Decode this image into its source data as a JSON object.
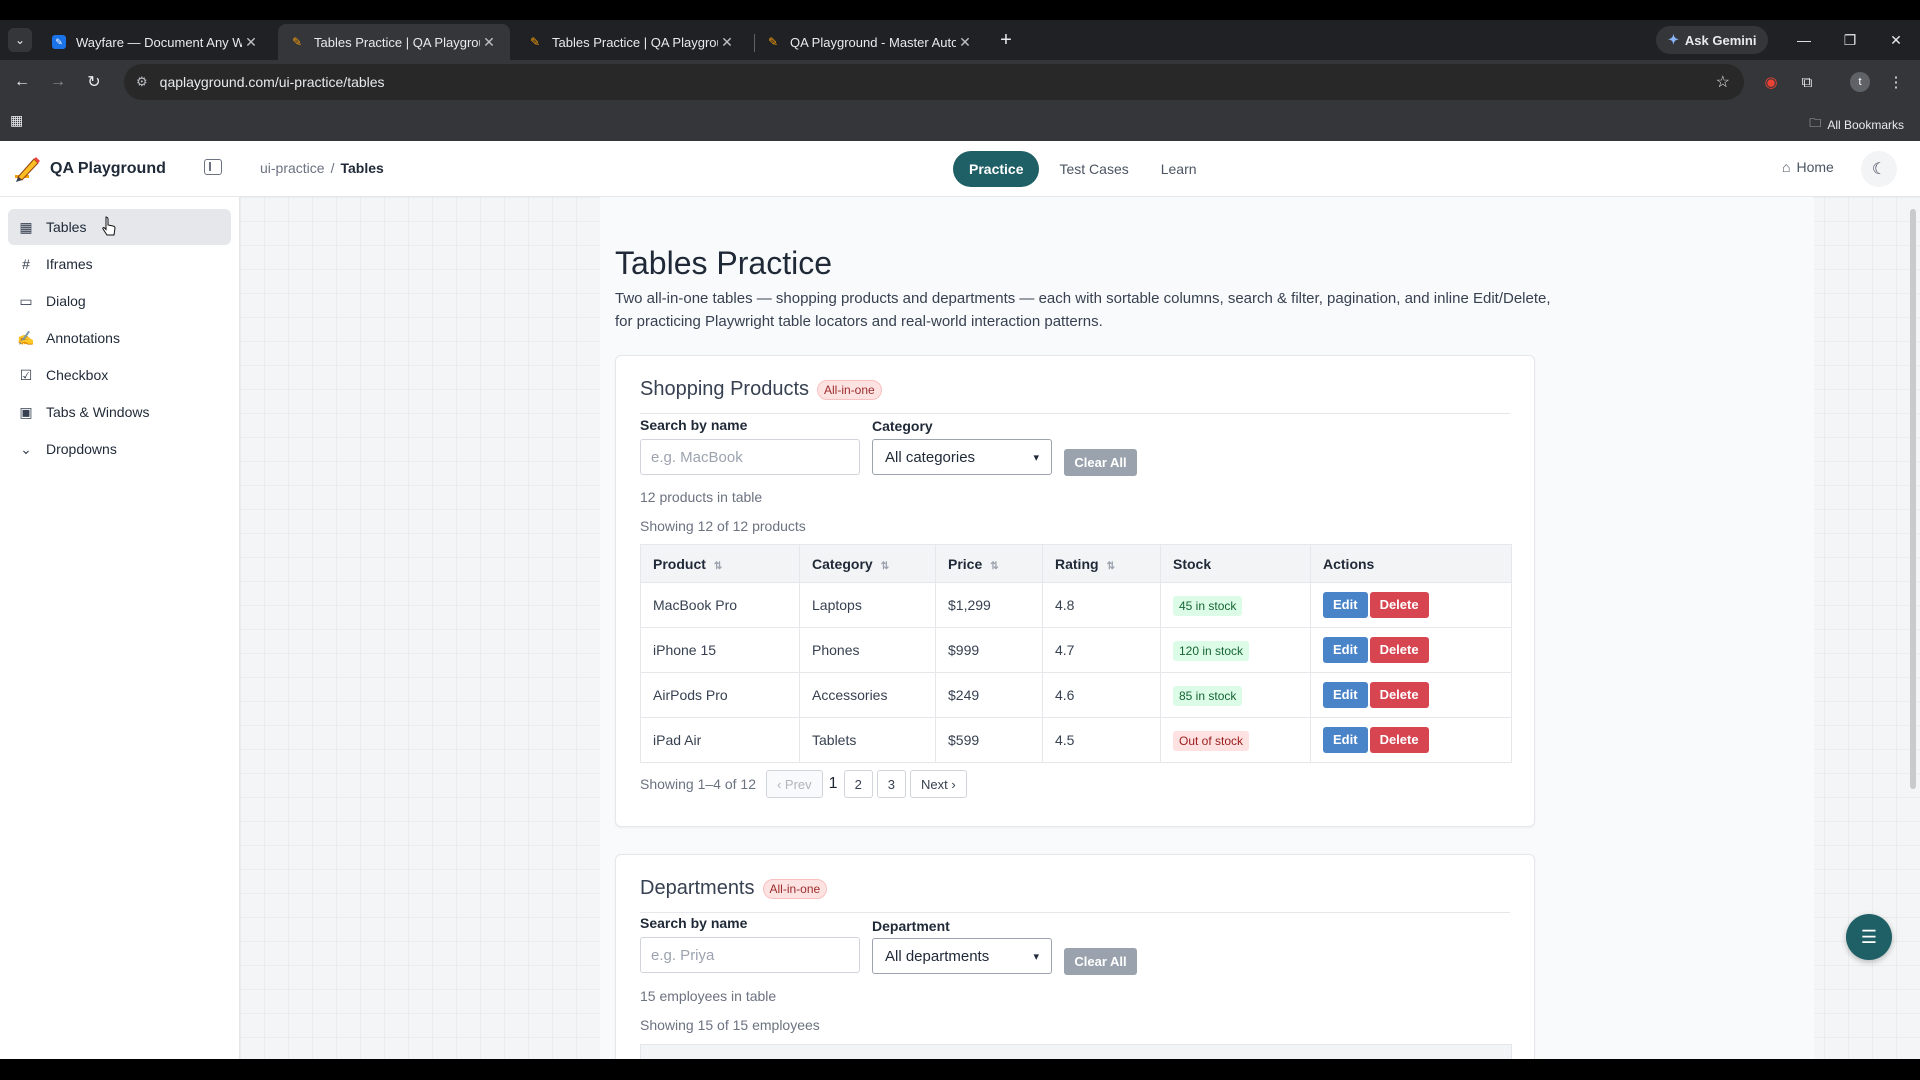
{
  "browser": {
    "tabs": [
      {
        "title": "Wayfare — Document Any Wor",
        "active": false,
        "favicon": "doc-icon"
      },
      {
        "title": "Tables Practice | QA Playground",
        "active": true,
        "favicon": "pencil-icon"
      },
      {
        "title": "Tables Practice | QA Playground",
        "active": false,
        "favicon": "pencil-icon"
      },
      {
        "title": "QA Playground - Master Autom",
        "active": false,
        "favicon": "pencil-icon"
      }
    ],
    "ask_gemini": "Ask Gemini",
    "url": "qaplayground.com/ui-practice/tables",
    "all_bookmarks": "All Bookmarks",
    "profile_initial": "t"
  },
  "app": {
    "brand": "QA Playground",
    "breadcrumb": {
      "parent": "ui-practice",
      "separator": "/",
      "current": "Tables"
    },
    "nav": [
      {
        "label": "Practice",
        "active": true
      },
      {
        "label": "Test Cases",
        "active": false
      },
      {
        "label": "Learn",
        "active": false
      }
    ],
    "home": "Home"
  },
  "sidebar": {
    "items": [
      {
        "label": "Tables",
        "icon": "table-icon",
        "active": true
      },
      {
        "label": "Iframes",
        "icon": "hash-icon",
        "active": false
      },
      {
        "label": "Dialog",
        "icon": "message-icon",
        "active": false
      },
      {
        "label": "Annotations",
        "icon": "pen-icon",
        "active": false
      },
      {
        "label": "Checkbox",
        "icon": "checkbox-icon",
        "active": false
      },
      {
        "label": "Tabs & Windows",
        "icon": "window-icon",
        "active": false
      },
      {
        "label": "Dropdowns",
        "icon": "chevron-down-icon",
        "active": false
      }
    ]
  },
  "page": {
    "title": "Tables Practice",
    "intro": "Two all-in-one tables — shopping products and departments — each with sortable columns, search & filter, pagination, and inline Edit/Delete, for practicing Playwright table locators and real-world interaction patterns."
  },
  "products": {
    "title": "Shopping Products",
    "badge": "All-in-one",
    "search_label": "Search by name",
    "search_placeholder": "e.g. MacBook",
    "category_label": "Category",
    "category_selected": "All categories",
    "clear": "Clear All",
    "count_text": "12 products in table",
    "showing_text": "Showing 12 of 12 products",
    "columns": [
      "Product",
      "Category",
      "Price",
      "Rating",
      "Stock",
      "Actions"
    ],
    "rows": [
      {
        "product": "MacBook Pro",
        "category": "Laptops",
        "price": "$1,299",
        "rating": "4.8",
        "stock": "45 in stock",
        "in_stock": true
      },
      {
        "product": "iPhone 15",
        "category": "Phones",
        "price": "$999",
        "rating": "4.7",
        "stock": "120 in stock",
        "in_stock": true
      },
      {
        "product": "AirPods Pro",
        "category": "Accessories",
        "price": "$249",
        "rating": "4.6",
        "stock": "85 in stock",
        "in_stock": true
      },
      {
        "product": "iPad Air",
        "category": "Tablets",
        "price": "$599",
        "rating": "4.5",
        "stock": "Out of stock",
        "in_stock": false
      }
    ],
    "edit_label": "Edit",
    "delete_label": "Delete",
    "pagination": {
      "summary": "Showing 1–4 of 12",
      "prev": "‹ Prev",
      "current": "1",
      "pages": [
        "2",
        "3"
      ],
      "next": "Next ›"
    }
  },
  "departments": {
    "title": "Departments",
    "badge": "All-in-one",
    "search_label": "Search by name",
    "search_placeholder": "e.g. Priya",
    "dept_label": "Department",
    "dept_selected": "All departments",
    "clear": "Clear All",
    "count_text": "15 employees in table",
    "showing_text": "Showing 15 of 15 employees"
  },
  "colors": {
    "accent": "#1f5f66",
    "edit": "#4a84c8",
    "delete": "#d64550"
  }
}
